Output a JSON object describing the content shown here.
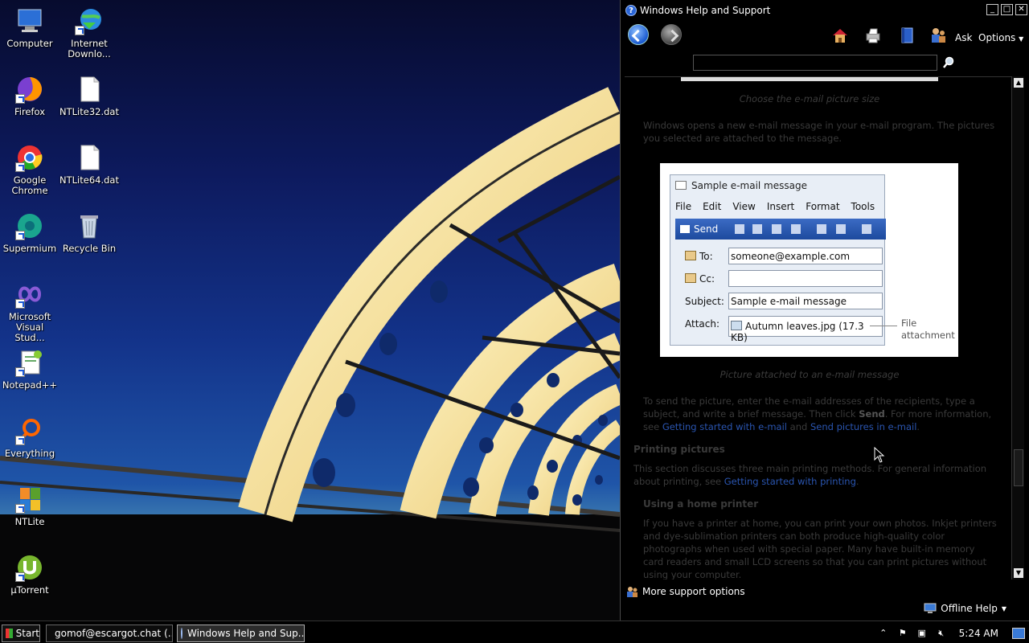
{
  "desktop": {
    "icons": [
      {
        "label": "Computer"
      },
      {
        "label": "Internet Downlo..."
      },
      {
        "label": "Firefox"
      },
      {
        "label": "NTLite32.dat"
      },
      {
        "label": "Google Chrome"
      },
      {
        "label": "NTLite64.dat"
      },
      {
        "label": "Supermium"
      },
      {
        "label": "Recycle Bin"
      },
      {
        "label": "Microsoft Visual Stud..."
      },
      {
        "label": "Notepad++"
      },
      {
        "label": "Everything"
      },
      {
        "label": "NTLite"
      },
      {
        "label": "µTorrent"
      }
    ]
  },
  "help_window": {
    "title": "Windows Help and Support",
    "toolbar": {
      "ask_label": "Ask",
      "options_label": "Options"
    },
    "search": {
      "placeholder": "",
      "value": ""
    },
    "content": {
      "caption_top": "Choose the e-mail picture size",
      "para1": "Windows opens a new e-mail message in your e-mail program. The pictures you selected are attached to the message.",
      "email_sample": {
        "title": "Sample e-mail message",
        "menu": [
          "File",
          "Edit",
          "View",
          "Insert",
          "Format",
          "Tools"
        ],
        "send_label": "Send",
        "to_label": "To:",
        "to_value": "someone@example.com",
        "cc_label": "Cc:",
        "cc_value": "",
        "subject_label": "Subject:",
        "subject_value": "Sample e-mail message",
        "attach_label": "Attach:",
        "attach_value": "Autumn leaves.jpg (17.3 KB)",
        "callout": "File attachment"
      },
      "caption_pic": "Picture attached to an e-mail message",
      "para2_a": "To send the picture, enter the e-mail addresses of the recipients, type a subject, and write a brief message. Then click ",
      "para2_bold": "Send",
      "para2_b": ". For more information, see ",
      "para2_link1": "Getting started with e-mail",
      "para2_c": " and ",
      "para2_link2": "Send pictures in e-mail",
      "para2_d": ".",
      "heading_printing": "Printing pictures",
      "para3_a": "This section discusses three main printing methods. For general information about printing, see ",
      "para3_link": "Getting started with printing",
      "para3_b": ".",
      "heading_home_printer": "Using a home printer",
      "para4": "If you have a printer at home, you can print your own photos. Inkjet printers and dye-sublimation printers can both produce high-quality color photographs when used with special paper. Many have built-in memory card readers and small LCD screens so that you can print pictures without using your computer."
    },
    "bottom": {
      "more_support": "More support options",
      "offline_help": "Offline Help"
    }
  },
  "taskbar": {
    "start_label": "Start",
    "tasks": [
      {
        "label": "gomof@escargot.chat (..."
      },
      {
        "label": "Windows Help and Sup..."
      }
    ],
    "clock": "5:24 AM"
  },
  "colors": {
    "link": "#2a55b0",
    "accent_blue": "#1d4a9e"
  }
}
